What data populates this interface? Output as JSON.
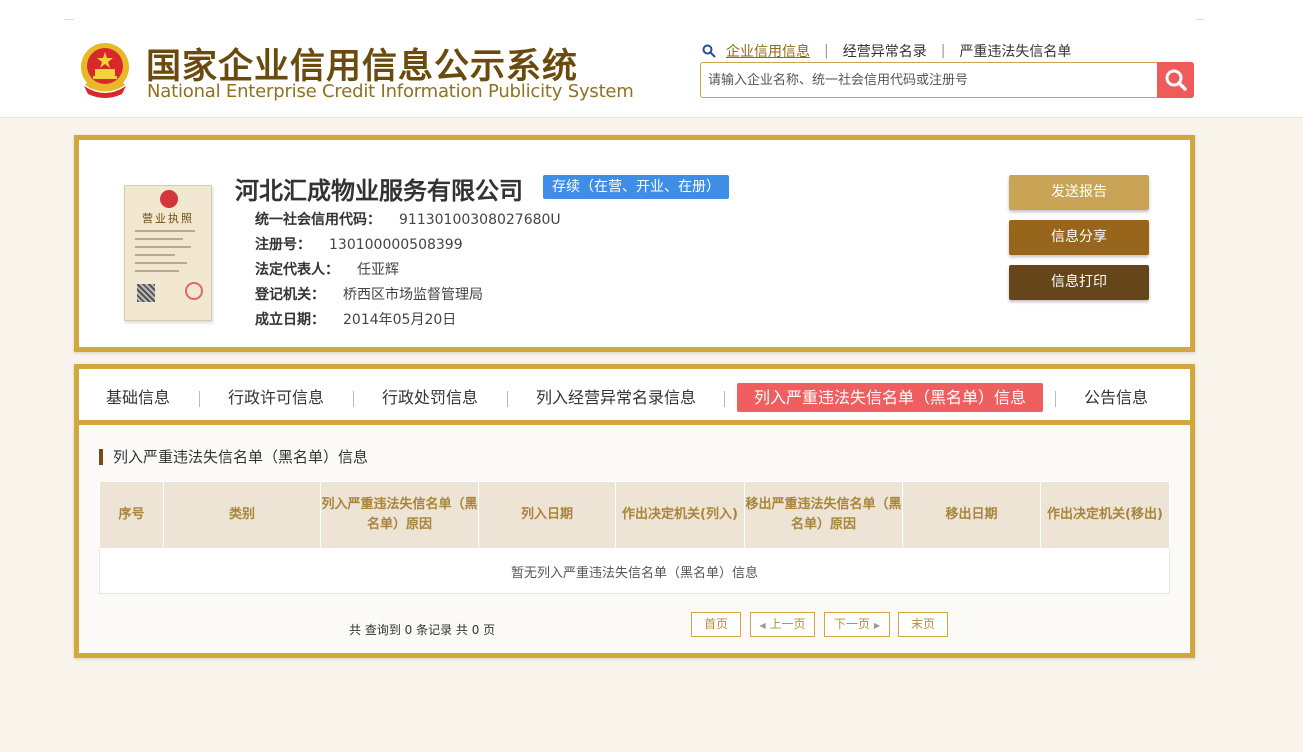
{
  "header": {
    "title_cn": "国家企业信用信息公示系统",
    "title_en": "National Enterprise Credit Information Publicity System",
    "nav": [
      "企业信用信息",
      "经营异常名录",
      "严重违法失信名单"
    ],
    "search_placeholder": "请输入企业名称、统一社会信用代码或注册号"
  },
  "company": {
    "license_title": "营业执照",
    "name": "河北汇成物业服务有限公司",
    "status": "存续（在营、开业、在册）",
    "fields": [
      {
        "label": "统一社会信用代码：",
        "value": "91130100308027680U"
      },
      {
        "label": "注册号：",
        "value": "130100000508399"
      },
      {
        "label": "法定代表人：",
        "value": "任亚辉"
      },
      {
        "label": "登记机关：",
        "value": "桥西区市场监督管理局"
      },
      {
        "label": "成立日期：",
        "value": "2014年05月20日"
      }
    ],
    "actions": [
      "发送报告",
      "信息分享",
      "信息打印"
    ]
  },
  "tabs": [
    "基础信息",
    "行政许可信息",
    "行政处罚信息",
    "列入经营异常名录信息",
    "列入严重违法失信名单（黑名单）信息",
    "公告信息"
  ],
  "section": {
    "title": "列入严重违法失信名单（黑名单）信息",
    "columns": [
      "序号",
      "类别",
      "列入严重违法失信名单（黑名单）原因",
      "列入日期",
      "作出决定机关(列入)",
      "移出严重违法失信名单（黑名单）原因",
      "移出日期",
      "作出决定机关(移出)"
    ],
    "empty_text": "暂无列入严重违法失信名单（黑名单）信息",
    "record_count": "共 查询到 0 条记录 共 0 页",
    "pager": {
      "first": "首页",
      "prev": "上一页",
      "next": "下一页",
      "last": "末页"
    }
  },
  "colors": {
    "gold": "#d1a73e",
    "brand_brown": "#6b4a0e",
    "accent_red": "#ef5f5f",
    "status_blue": "#3f8ee6"
  }
}
